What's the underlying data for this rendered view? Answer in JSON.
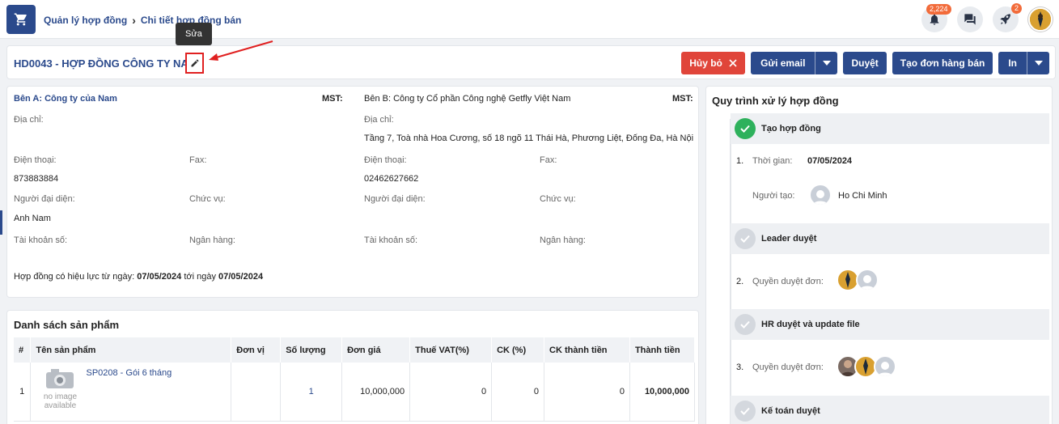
{
  "header": {
    "breadcrumb": [
      "Quản lý hợp đồng",
      "Chi tiết hợp đồng bán"
    ],
    "notifications_count": "2,224",
    "rocket_count": "2"
  },
  "tooltip": {
    "text": "Sửa"
  },
  "title": {
    "text": "HD0043 - HỢP ĐỒNG CÔNG TY NAM",
    "actions": {
      "cancel": "Hủy bỏ",
      "send_email": "Gửi email",
      "approve": "Duyệt",
      "create_order": "Tạo đơn hàng bán",
      "print": "In"
    }
  },
  "info": {
    "party_a": {
      "name": "Bên A: Công ty của Nam",
      "mst": "MST:",
      "address_label": "Địa chỉ:",
      "address": "",
      "phone_label": "Điện thoại:",
      "phone": "873883884",
      "fax_label": "Fax:",
      "rep_label": "Người đại diện:",
      "rep": "Anh Nam",
      "position_label": "Chức vụ:",
      "account_label": "Tài khoản số:",
      "bank_label": "Ngân hàng:"
    },
    "party_b": {
      "name": "Bên B: Công ty Cổ phần Công nghệ Getfly Việt Nam",
      "mst": "MST:",
      "address_label": "Địa chỉ:",
      "address": "Tầng 7, Toà nhà Hoa Cương, số 18 ngõ 11 Thái Hà, Phương Liệt, Đống Đa, Hà Nội",
      "phone_label": "Điện thoại:",
      "phone": "02462627662",
      "fax_label": "Fax:",
      "rep_label": "Người đại diện:",
      "position_label": "Chức vụ:",
      "account_label": "Tài khoản số:",
      "bank_label": "Ngân hàng:"
    },
    "effective_prefix": "Hợp đồng có hiệu lực từ ngày:",
    "effective_from": "07/05/2024",
    "effective_mid": "tới ngày",
    "effective_to": "07/05/2024"
  },
  "products": {
    "title": "Danh sách sản phẩm",
    "columns": [
      "#",
      "Tên sản phẩm",
      "Đơn vị",
      "Số lượng",
      "Đơn giá",
      "Thuế VAT(%)",
      "CK (%)",
      "CK thành tiền",
      "Thành tiền"
    ],
    "rows": [
      {
        "index": "1",
        "name": "SP0208 - Gói 6 tháng",
        "no_image": "no image available",
        "unit": "",
        "quantity": "1",
        "price": "10,000,000",
        "vat": "0",
        "discount_pct": "0",
        "discount_amount": "0",
        "total": "10,000,000"
      }
    ]
  },
  "workflow": {
    "title": "Quy trình xử lý hợp đồng",
    "steps": [
      {
        "name": "Tạo hợp đồng",
        "done": true
      },
      {
        "name": "Leader duyệt",
        "done": false
      },
      {
        "name": "HR duyệt và update file",
        "done": false
      },
      {
        "name": "Kế toán duyệt",
        "done": false
      }
    ],
    "details": {
      "num1": "1.",
      "time_label": "Thời gian:",
      "time": "07/05/2024",
      "creator_label": "Người tạo:",
      "creator": "Ho Chi Minh",
      "num2": "2.",
      "approvers_label_2": "Quyền duyệt đơn:",
      "num3": "3.",
      "approvers_label_3": "Quyền duyệt đơn:"
    }
  },
  "colors": {
    "primary": "#2b4a8c",
    "danger": "#e0453a",
    "success": "#2eb15c"
  }
}
